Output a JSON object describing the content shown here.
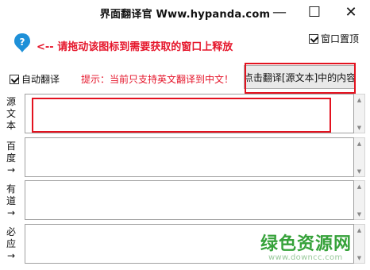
{
  "window": {
    "title": "界面翻译官  Www.hypanda.com",
    "minimize_glyph": "—",
    "maximize_glyph": "☐",
    "close_glyph": "✕"
  },
  "drag": {
    "icon": "drop-pin-icon",
    "hint": "<-- 请拖动该图标到需要获取的窗口上释放"
  },
  "topmost": {
    "label": "窗口置顶",
    "checked": true
  },
  "auto_translate": {
    "label": "自动翻译",
    "checked": true
  },
  "tip": "提示：当前只支持英文翻译到中文！",
  "translate_button": "点击翻译[源文本]中的内容",
  "panels": [
    {
      "label": "源文本",
      "value": ""
    },
    {
      "label": "百度→",
      "value": ""
    },
    {
      "label": "有道→",
      "value": ""
    },
    {
      "label": "必应→",
      "value": ""
    }
  ],
  "watermark": {
    "text": "绿色资源网",
    "url": "www.downcc.com"
  },
  "colors": {
    "accent_red": "#e5162b",
    "icon_blue": "#1e90d8",
    "watermark_green": "#36a23a"
  }
}
